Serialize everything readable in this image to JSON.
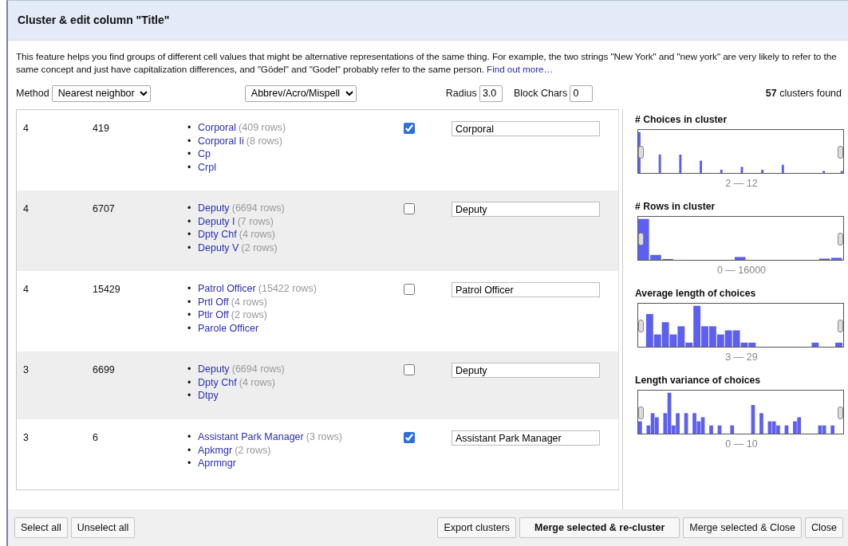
{
  "dialog": {
    "title": "Cluster & edit column \"Title\""
  },
  "description": {
    "text": "This feature helps you find groups of different cell values that might be alternative representations of the same thing. For example, the two strings \"New York\" and \"new york\" are very likely to refer to the same concept and just have capitalization differences, and \"Gödel\" and \"Godel\" probably refer to the same person.",
    "link": "Find out more…"
  },
  "controls": {
    "method_label": "Method",
    "method": "Nearest neighbor",
    "function": "Abbrev/Acro/Mispell",
    "radius_label": "Radius",
    "radius": "3.0",
    "block_chars_label": "Block Chars",
    "block_chars": "0",
    "count": "57",
    "count_suffix": "clusters found"
  },
  "clusters": [
    {
      "size": "4",
      "row_count": "419",
      "values": [
        {
          "marker": "•",
          "value": "Corporal",
          "rows": "(409 rows)"
        },
        {
          "marker": "•",
          "value": "Corporal Ii",
          "rows": "(8 rows)"
        },
        {
          "marker": "•",
          "value": "Cp"
        },
        {
          "marker": "•",
          "value": "Crpl"
        }
      ],
      "checked": true,
      "new_value": "Corporal"
    },
    {
      "size": "4",
      "row_count": "6707",
      "values": [
        {
          "marker": "•",
          "value": "Deputy",
          "rows": "(6694 rows)"
        },
        {
          "marker": "•",
          "value": "Deputy I",
          "rows": "(7 rows)"
        },
        {
          "marker": "•",
          "value": "Dpty Chf",
          "rows": "(4 rows)"
        },
        {
          "marker": "•",
          "value": "Deputy V",
          "rows": "(2 rows)"
        }
      ],
      "checked": false,
      "new_value": "Deputy"
    },
    {
      "size": "4",
      "row_count": "15429",
      "values": [
        {
          "marker": "•",
          "value": "Patrol Officer",
          "rows": "(15422 rows)"
        },
        {
          "marker": "•",
          "value": "Prtl Off",
          "rows": "(4 rows)"
        },
        {
          "marker": "•",
          "value": "Ptlr Off",
          "rows": "(2 rows)"
        },
        {
          "marker": "•",
          "value": "Parole Officer"
        }
      ],
      "checked": false,
      "new_value": "Patrol Officer"
    },
    {
      "size": "3",
      "row_count": "6699",
      "values": [
        {
          "marker": "•",
          "value": "Deputy",
          "rows": "(6694 rows)"
        },
        {
          "marker": "•",
          "value": "Dpty Chf",
          "rows": "(4 rows)"
        },
        {
          "marker": "•",
          "value": "Dtpy"
        }
      ],
      "checked": false,
      "new_value": "Deputy"
    },
    {
      "size": "3",
      "row_count": "6",
      "values": [
        {
          "marker": "•",
          "value": "Assistant Park Manager",
          "rows": "(3 rows)"
        },
        {
          "marker": "•",
          "value": "Apkmgr",
          "rows": "(2 rows)"
        },
        {
          "marker": "•",
          "value": "Aprmngr"
        }
      ],
      "checked": true,
      "new_value": "Assistant Park Manager"
    }
  ],
  "facets": [
    {
      "title": "# Choices in cluster",
      "range": "2 — 12"
    },
    {
      "title": "# Rows in cluster",
      "range": "0 — 16000"
    },
    {
      "title": "Average length of choices",
      "range": "3 — 29"
    },
    {
      "title": "Length variance of choices",
      "range": "0 — 10"
    }
  ],
  "buttons_left": [
    "Select all",
    "Unselect all"
  ],
  "buttons_right": [
    {
      "label": "Export clusters",
      "primary": false
    },
    {
      "label": "Merge selected & re-cluster",
      "primary": true
    },
    {
      "label": "Merge selected & Close",
      "primary": false
    },
    {
      "label": "Close",
      "primary": false
    }
  ]
}
